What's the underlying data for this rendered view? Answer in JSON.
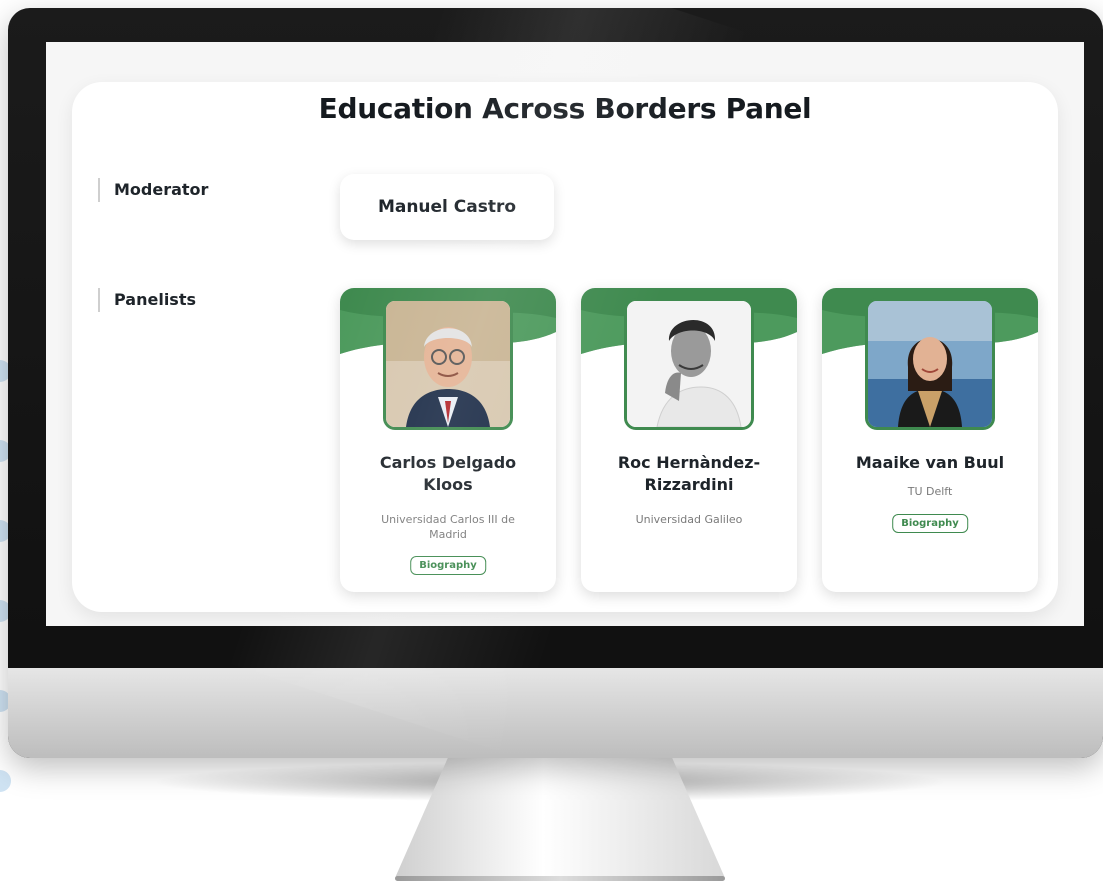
{
  "panel": {
    "title": "Education Across Borders Panel",
    "moderator_label": "Moderator",
    "panelists_label": "Panelists",
    "moderator_name": "Manuel Castro"
  },
  "panelists": [
    {
      "name_line1": "Carlos Delgado",
      "name_line2": "Kloos",
      "affiliation_line1": "Universidad Carlos III de",
      "affiliation_line2": "Madrid",
      "button": "Biography",
      "photo_icon": "portrait-man-glasses"
    },
    {
      "name_line1": "Roc Hernàndez-",
      "name_line2": "Rizzardini",
      "affiliation_line1": "Universidad Galileo",
      "affiliation_line2": "",
      "button": "",
      "photo_icon": "portrait-man-bw"
    },
    {
      "name_line1": "Maaike van Buul",
      "name_line2": "",
      "affiliation_line1": "TU Delft",
      "affiliation_line2": "",
      "button": "Biography",
      "photo_icon": "portrait-woman"
    }
  ],
  "colors": {
    "accent_green": "#3f8a4f",
    "accent_green_light": "#5aa86a",
    "monitor_bezel": "#151515"
  }
}
